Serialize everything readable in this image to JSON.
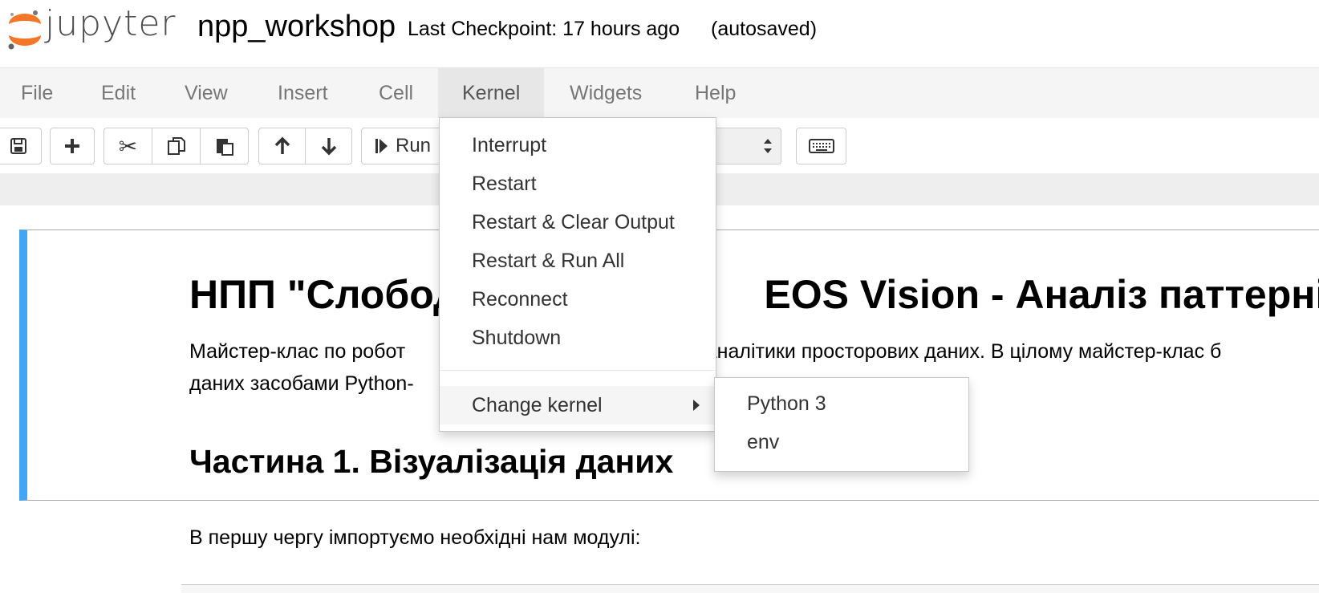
{
  "header": {
    "logo_text": "jupyter",
    "notebook_name": "npp_workshop",
    "checkpoint": "Last Checkpoint: 17 hours ago",
    "autosave": "(autosaved)"
  },
  "menubar": {
    "items": [
      {
        "label": "File"
      },
      {
        "label": "Edit"
      },
      {
        "label": "View"
      },
      {
        "label": "Insert"
      },
      {
        "label": "Cell"
      },
      {
        "label": "Kernel"
      },
      {
        "label": "Widgets"
      },
      {
        "label": "Help"
      }
    ],
    "open_menu": "Kernel"
  },
  "toolbar": {
    "run_label": "Run",
    "buttons": [
      "save-icon",
      "plus-icon",
      "scissors-icon",
      "copy-icon",
      "paste-icon",
      "arrow-up-icon",
      "arrow-down-icon",
      "step-forward-icon",
      "keyboard-icon"
    ]
  },
  "kernel_menu": {
    "items": [
      {
        "label": "Interrupt"
      },
      {
        "label": "Restart"
      },
      {
        "label": "Restart & Clear Output"
      },
      {
        "label": "Restart & Run All"
      },
      {
        "label": "Reconnect"
      },
      {
        "label": "Shutdown"
      }
    ],
    "change_kernel": "Change kernel",
    "kernels": [
      {
        "label": "Python 3"
      },
      {
        "label": "env"
      }
    ]
  },
  "notebook": {
    "heading": "НПП \"Слободо",
    "heading_tail": "EOS Vision - Аналіз паттернів",
    "para1_left": "Майстер-клас по робот",
    "para1_right": "я аналітики просторових даних. В цілому майстер-клас б",
    "para2_left": "даних засобами Python-",
    "section_heading": "Частина 1. Візуалізація даних",
    "text_after": "В першу чергу імпортуємо необхідні нам модулі:"
  },
  "colors": {
    "accent_cell_border": "#42a5f5",
    "logo_orange": "#f37726",
    "menubar_bg": "#f5f5f5"
  }
}
